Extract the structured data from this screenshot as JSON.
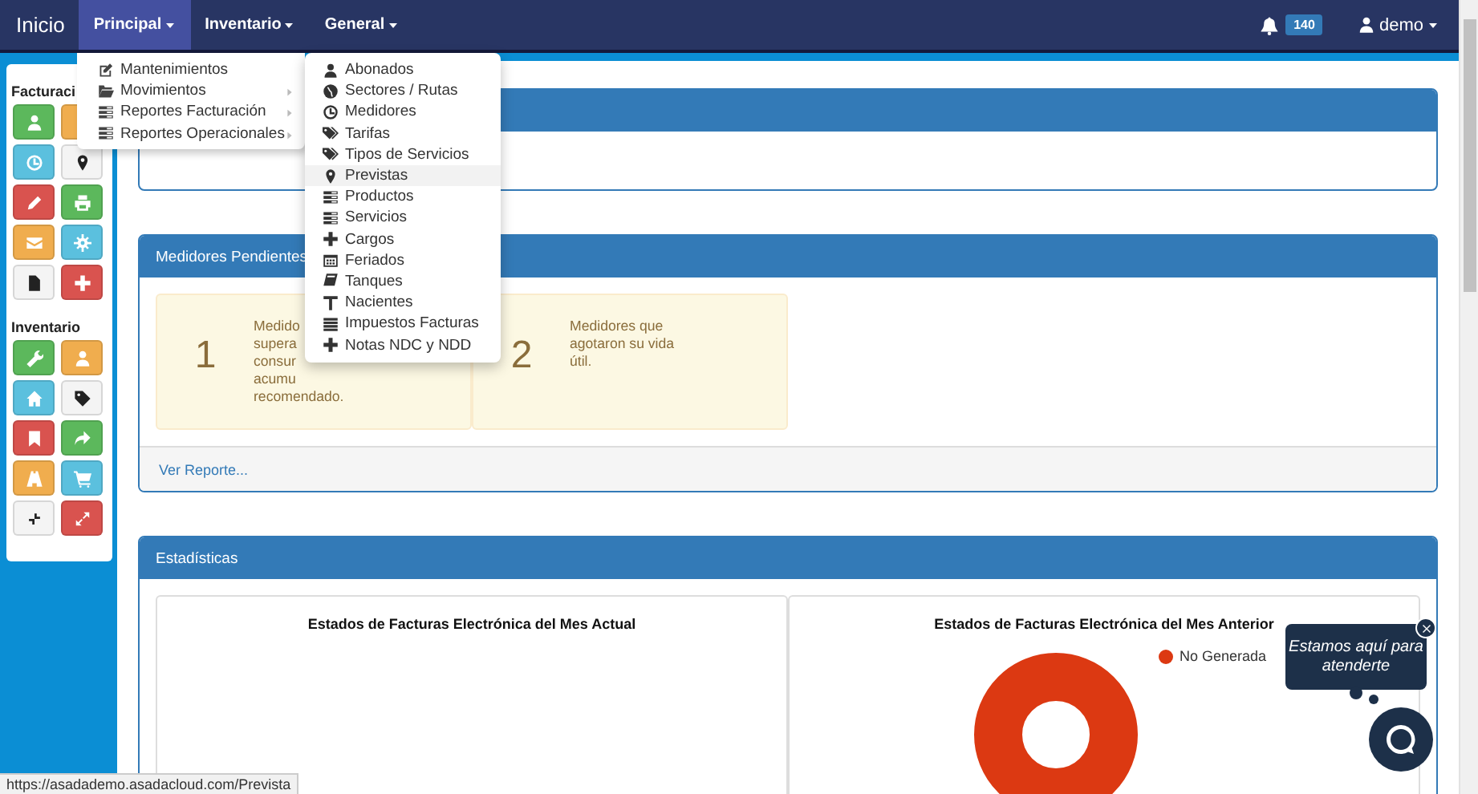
{
  "navbar": {
    "brand": "Inicio",
    "items": [
      {
        "label": "Principal",
        "selected": true
      },
      {
        "label": "Inventario",
        "selected": false
      },
      {
        "label": "General",
        "selected": false
      }
    ],
    "notifications": "140",
    "user": "demo"
  },
  "principal_menu": [
    {
      "label": "Mantenimientos",
      "arrow": false,
      "children": [
        {
          "label": "Abonados",
          "selected": false
        },
        {
          "label": "Sectores / Rutas",
          "selected": false
        },
        {
          "label": "Medidores",
          "selected": false
        },
        {
          "label": "Tarifas",
          "selected": false
        },
        {
          "label": "Tipos de Servicios",
          "selected": false
        },
        {
          "label": "Previstas",
          "selected": true
        },
        {
          "label": "Productos",
          "selected": false
        },
        {
          "label": "Servicios",
          "selected": false
        },
        {
          "label": "Cargos",
          "selected": false
        },
        {
          "label": "Feriados",
          "selected": false
        },
        {
          "label": "Tanques",
          "selected": false
        },
        {
          "label": "Nacientes",
          "selected": false
        },
        {
          "label": "Impuestos Facturas",
          "selected": false
        },
        {
          "label": "Notas NDC y NDD",
          "selected": false
        }
      ]
    },
    {
      "label": "Movimientos",
      "arrow": true
    },
    {
      "label": "Reportes Facturación",
      "arrow": true
    },
    {
      "label": "Reportes Operacionales",
      "arrow": true
    }
  ],
  "sidebar": {
    "sections": [
      {
        "title": "Facturaci",
        "buttons": [
          {
            "color": "#5cb85c"
          },
          {
            "color": "#f0ad4e"
          },
          {
            "color": "#5bc0de"
          },
          {
            "color": "#f4f4f4"
          },
          {
            "color": "#d9534f"
          },
          {
            "color": "#5cb85c"
          },
          {
            "color": "#f0ad4e"
          },
          {
            "color": "#5bc0de"
          },
          {
            "color": "#f4f4f4"
          },
          {
            "color": "#d9534f"
          }
        ]
      },
      {
        "title": "Inventario",
        "buttons": [
          {
            "color": "#5cb85c"
          },
          {
            "color": "#f0ad4e"
          },
          {
            "color": "#5bc0de"
          },
          {
            "color": "#f4f4f4"
          },
          {
            "color": "#d9534f"
          },
          {
            "color": "#5cb85c"
          },
          {
            "color": "#f0ad4e"
          },
          {
            "color": "#5bc0de"
          },
          {
            "color": "#f4f4f4"
          },
          {
            "color": "#d9534f"
          }
        ]
      }
    ]
  },
  "panels": [
    {
      "kind": "empty"
    },
    {
      "kind": "alerts",
      "title": "Medidores Pendientes",
      "alerts": [
        {
          "count": "1",
          "lines": [
            "Medido",
            "supera",
            "consur",
            "acumu",
            "recomendado."
          ]
        },
        {
          "count": "2",
          "lines": [
            "Medidores que",
            "agotaron su vida",
            "útil."
          ]
        }
      ],
      "footer_link": "Ver Reporte..."
    },
    {
      "kind": "charts",
      "title": "Estadísticas",
      "charts": [
        {
          "title": "Estados de Facturas Electrónica del Mes Actual"
        },
        {
          "title": "Estados de Facturas Electrónica del Mes Anterior",
          "legend": [
            {
              "label": "No Generada",
              "color": "#dc3912"
            }
          ]
        }
      ]
    }
  ],
  "chat": {
    "bubble": "Estamos aquí para atenderte"
  },
  "status_bar": "https://asadademo.asadacloud.com/Prevista"
}
